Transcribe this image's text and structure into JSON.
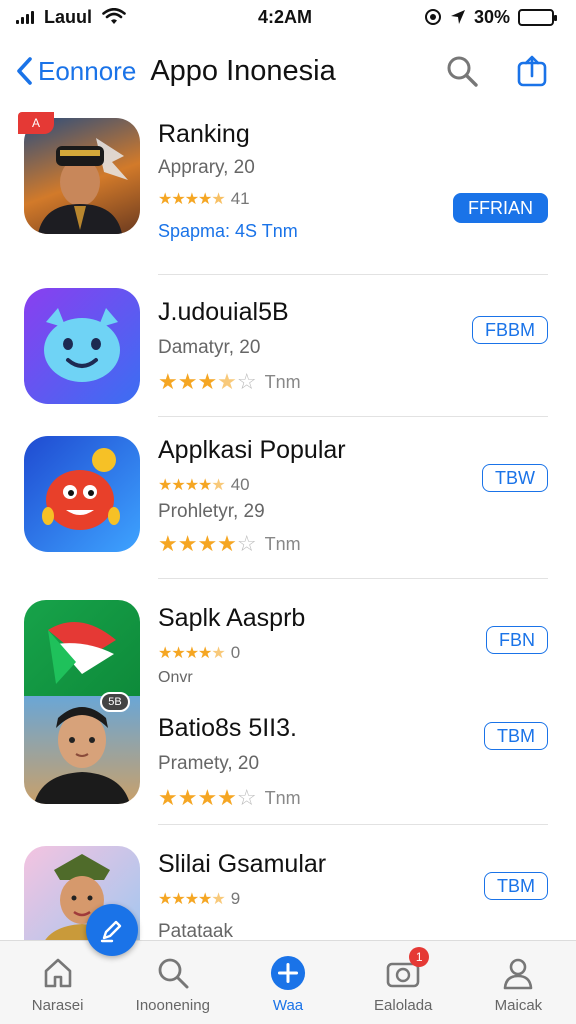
{
  "status_bar": {
    "carrier": "Lauul",
    "time": "4:2AM",
    "battery": "30%",
    "battery_level": 0.3
  },
  "nav": {
    "back_label": "Eonnore",
    "title": "Appo Inonesia",
    "search_icon": "search-icon",
    "share_icon": "share-icon"
  },
  "apps": [
    {
      "name": "Ranking",
      "subtitle": "Apprary, 20",
      "rating_count": "41",
      "extra": "Spapma: 4S Tnm",
      "button": "FFRIAN",
      "stars": 4.5,
      "icon": "portrait-icon"
    },
    {
      "name": "J.udouial5B",
      "subtitle": "Damatyr, 20",
      "extra": "Tnm",
      "button": "FBBM",
      "stars": 3.5,
      "icon": "blue-creature-icon"
    },
    {
      "name": "Applkasi Popular",
      "rating_count": "40",
      "subtitle": "Prohletyr, 29",
      "extra": "Tnm",
      "button": "TBW",
      "stars": 4,
      "icon": "red-monster-icon"
    },
    {
      "name": "Saplk Aasprb",
      "rating_count": "0",
      "subtitle": "Onvr",
      "button": "FBN",
      "stars": 4.5,
      "icon": "green-app-icon"
    },
    {
      "name": "Batio8s 5II3.",
      "subtitle": "Pramety, 20",
      "extra": "Tnm",
      "button": "TBM",
      "stars": 4,
      "badge": "5B",
      "icon": "young-man-portrait-icon"
    },
    {
      "name": "Slilai Gsamular",
      "rating_count": "9",
      "subtitle": "Patataak",
      "button": "TBM",
      "stars": 4.5,
      "icon": "woman-portrait-icon"
    }
  ],
  "tabs": [
    {
      "label": "Narasei",
      "icon": "home-icon"
    },
    {
      "label": "Inoonening",
      "icon": "search-icon"
    },
    {
      "label": "Waa",
      "icon": "plus-icon"
    },
    {
      "label": "Ealolada",
      "icon": "camera-icon",
      "badge": "1"
    },
    {
      "label": "Maicak",
      "icon": "person-icon"
    }
  ],
  "colors": {
    "accent": "#1a73e8",
    "star": "#f5a623",
    "badge": "#e53935"
  },
  "icon_badge": "A"
}
